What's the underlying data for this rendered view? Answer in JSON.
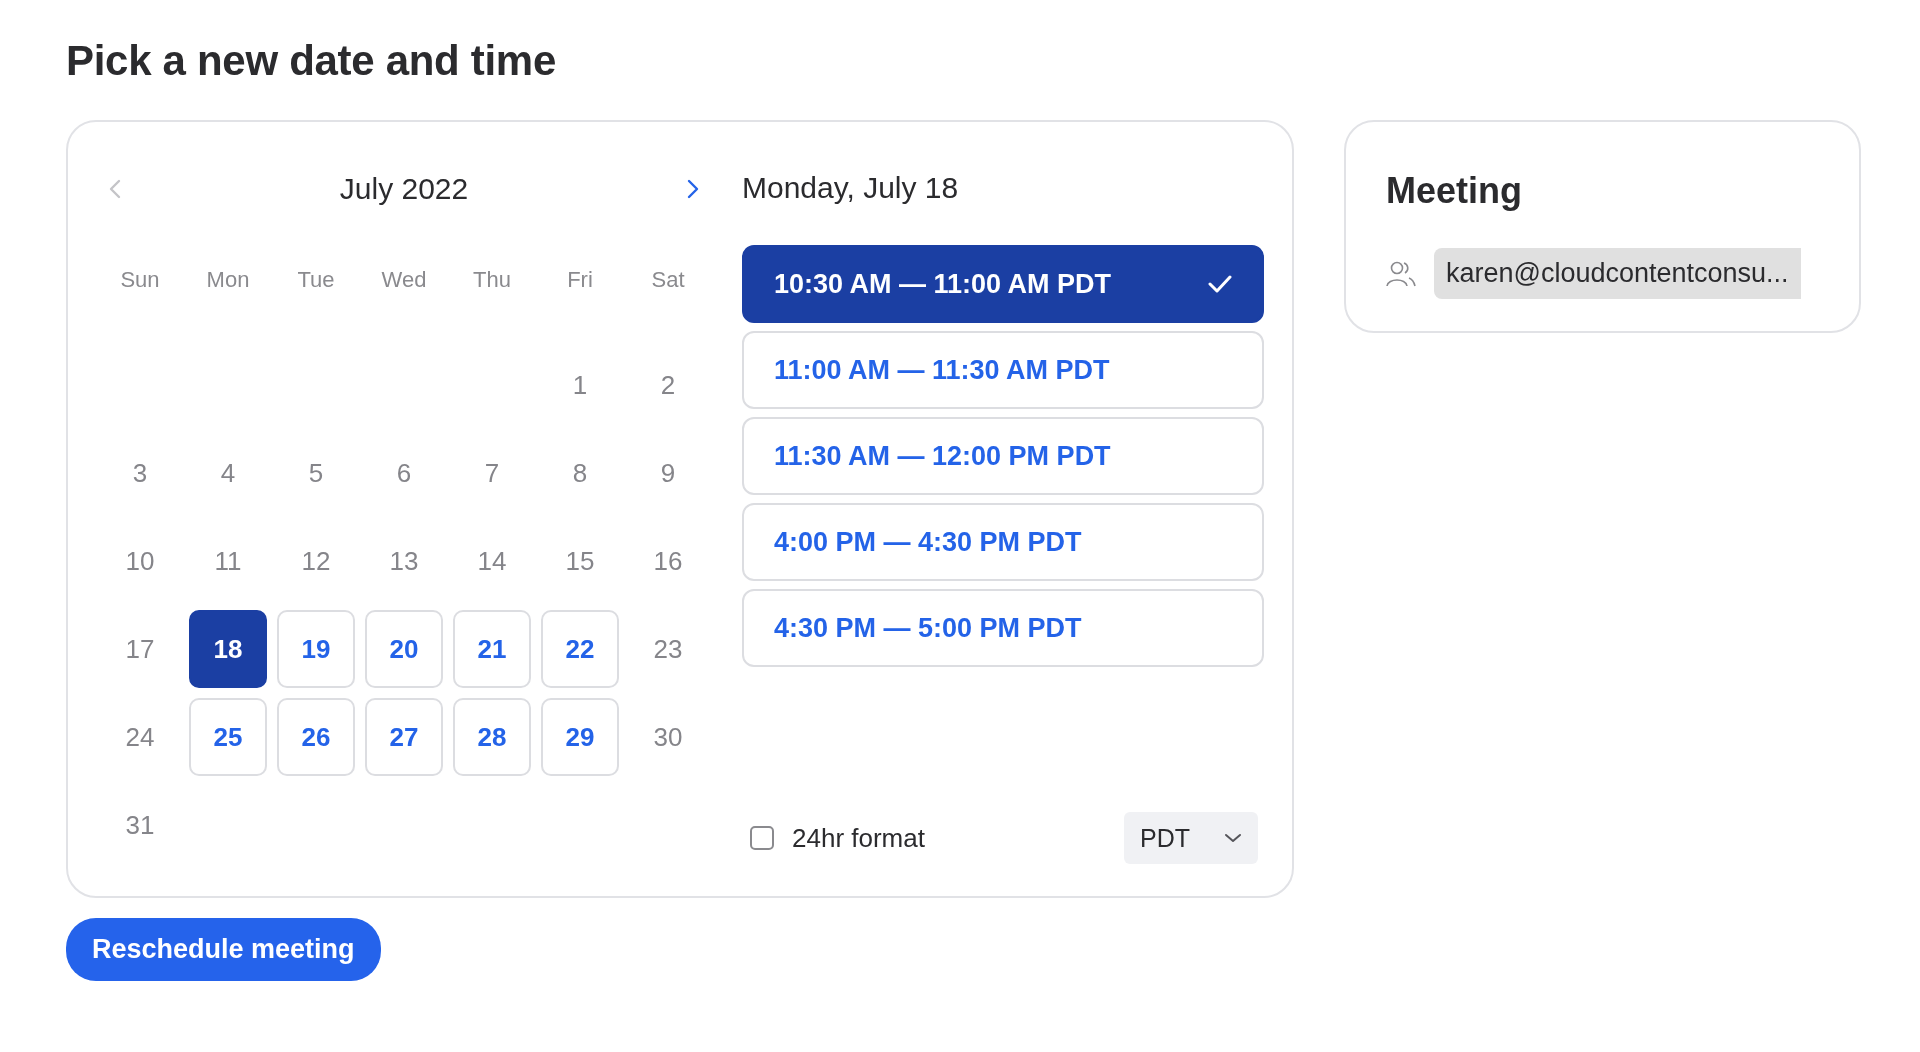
{
  "page_title": "Pick a new date and time",
  "calendar": {
    "month": "July 2022",
    "prev": {
      "disabled": true
    },
    "next": {
      "disabled": false
    },
    "weekdays": [
      "Sun",
      "Mon",
      "Tue",
      "Wed",
      "Thu",
      "Fri",
      "Sat"
    ],
    "weeks": [
      [
        {
          "kind": "blank"
        },
        {
          "kind": "blank"
        },
        {
          "kind": "blank"
        },
        {
          "kind": "blank"
        },
        {
          "kind": "blank"
        },
        {
          "kind": "day",
          "day": "1",
          "available": false,
          "selected": false
        },
        {
          "kind": "day",
          "day": "2",
          "available": false,
          "selected": false
        }
      ],
      [
        {
          "kind": "day",
          "day": "3",
          "available": false,
          "selected": false
        },
        {
          "kind": "day",
          "day": "4",
          "available": false,
          "selected": false
        },
        {
          "kind": "day",
          "day": "5",
          "available": false,
          "selected": false
        },
        {
          "kind": "day",
          "day": "6",
          "available": false,
          "selected": false
        },
        {
          "kind": "day",
          "day": "7",
          "available": false,
          "selected": false
        },
        {
          "kind": "day",
          "day": "8",
          "available": false,
          "selected": false
        },
        {
          "kind": "day",
          "day": "9",
          "available": false,
          "selected": false
        }
      ],
      [
        {
          "kind": "day",
          "day": "10",
          "available": false,
          "selected": false
        },
        {
          "kind": "day",
          "day": "11",
          "available": false,
          "selected": false
        },
        {
          "kind": "day",
          "day": "12",
          "available": false,
          "selected": false
        },
        {
          "kind": "day",
          "day": "13",
          "available": false,
          "selected": false
        },
        {
          "kind": "day",
          "day": "14",
          "available": false,
          "selected": false
        },
        {
          "kind": "day",
          "day": "15",
          "available": false,
          "selected": false
        },
        {
          "kind": "day",
          "day": "16",
          "available": false,
          "selected": false
        }
      ],
      [
        {
          "kind": "day",
          "day": "17",
          "available": false,
          "selected": false
        },
        {
          "kind": "day",
          "day": "18",
          "available": true,
          "selected": true
        },
        {
          "kind": "day",
          "day": "19",
          "available": true,
          "selected": false
        },
        {
          "kind": "day",
          "day": "20",
          "available": true,
          "selected": false
        },
        {
          "kind": "day",
          "day": "21",
          "available": true,
          "selected": false
        },
        {
          "kind": "day",
          "day": "22",
          "available": true,
          "selected": false
        },
        {
          "kind": "day",
          "day": "23",
          "available": false,
          "selected": false
        }
      ],
      [
        {
          "kind": "day",
          "day": "24",
          "available": false,
          "selected": false
        },
        {
          "kind": "day",
          "day": "25",
          "available": true,
          "selected": false
        },
        {
          "kind": "day",
          "day": "26",
          "available": true,
          "selected": false
        },
        {
          "kind": "day",
          "day": "27",
          "available": true,
          "selected": false
        },
        {
          "kind": "day",
          "day": "28",
          "available": true,
          "selected": false
        },
        {
          "kind": "day",
          "day": "29",
          "available": true,
          "selected": false
        },
        {
          "kind": "day",
          "day": "30",
          "available": false,
          "selected": false
        }
      ],
      [
        {
          "kind": "day",
          "day": "31",
          "available": false,
          "selected": false
        }
      ]
    ]
  },
  "slots": {
    "date_heading": "Monday, July 18",
    "items": [
      {
        "label": "10:30 AM — 11:00 AM PDT",
        "selected": true
      },
      {
        "label": "11:00 AM — 11:30 AM PDT",
        "selected": false
      },
      {
        "label": "11:30 AM — 12:00 PM PDT",
        "selected": false
      },
      {
        "label": "4:00 PM — 4:30 PM PDT",
        "selected": false
      },
      {
        "label": "4:30 PM — 5:00 PM PDT",
        "selected": false
      }
    ],
    "format_24hr": {
      "label": "24hr format",
      "checked": false
    },
    "timezone": {
      "value": "PDT"
    }
  },
  "meeting": {
    "title": "Meeting",
    "attendee": "karen@cloudcontentconsu..."
  },
  "action_button": "Reschedule meeting"
}
